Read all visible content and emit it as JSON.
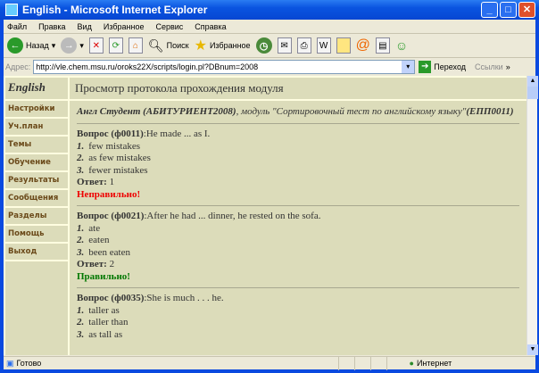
{
  "window": {
    "title": "English - Microsoft Internet Explorer"
  },
  "menu": [
    "Файл",
    "Правка",
    "Вид",
    "Избранное",
    "Сервис",
    "Справка"
  ],
  "toolbar": {
    "back": "Назад",
    "search": "Поиск",
    "favorites": "Избранное"
  },
  "address": {
    "label": "Адрес:",
    "url": "http://vle.chem.msu.ru/oroks22X/scripts/login.pl?DBnum=2008",
    "go": "Переход",
    "links": "Ссылки"
  },
  "nav": {
    "title": "English",
    "items": [
      "Настройки",
      "Уч.план",
      "Темы",
      "Обучение",
      "Результаты",
      "Сообщения",
      "Разделы",
      "Помощь",
      "Выход"
    ]
  },
  "main": {
    "title": "Просмотр протокола прохождения модуля",
    "student": "Англ Студент (АБИТУРИЕНТ2008)",
    "module_prefix": ", модуль \"Сортировочный тест по английскому языку\"",
    "module_code": "(ЕПП0011)",
    "answer_label": "Ответ:",
    "questions": [
      {
        "label": "Вопрос (ф0011)",
        "text": ":He made ... as I.",
        "options": [
          "few mistakes",
          "as few mistakes",
          "fewer mistakes"
        ],
        "answer": "1",
        "result": "Неправильно!",
        "correct": false
      },
      {
        "label": "Вопрос (ф0021)",
        "text": ":After he had ... dinner, he rested on the sofa.",
        "options": [
          "ate",
          "eaten",
          "been eaten"
        ],
        "answer": "2",
        "result": "Правильно!",
        "correct": true
      },
      {
        "label": "Вопрос (ф0035)",
        "text": ":She is much . . . he.",
        "options": [
          "taller as",
          "taller than",
          "as tall as"
        ]
      }
    ]
  },
  "status": {
    "text": "Готово",
    "zone": "Интернет"
  }
}
